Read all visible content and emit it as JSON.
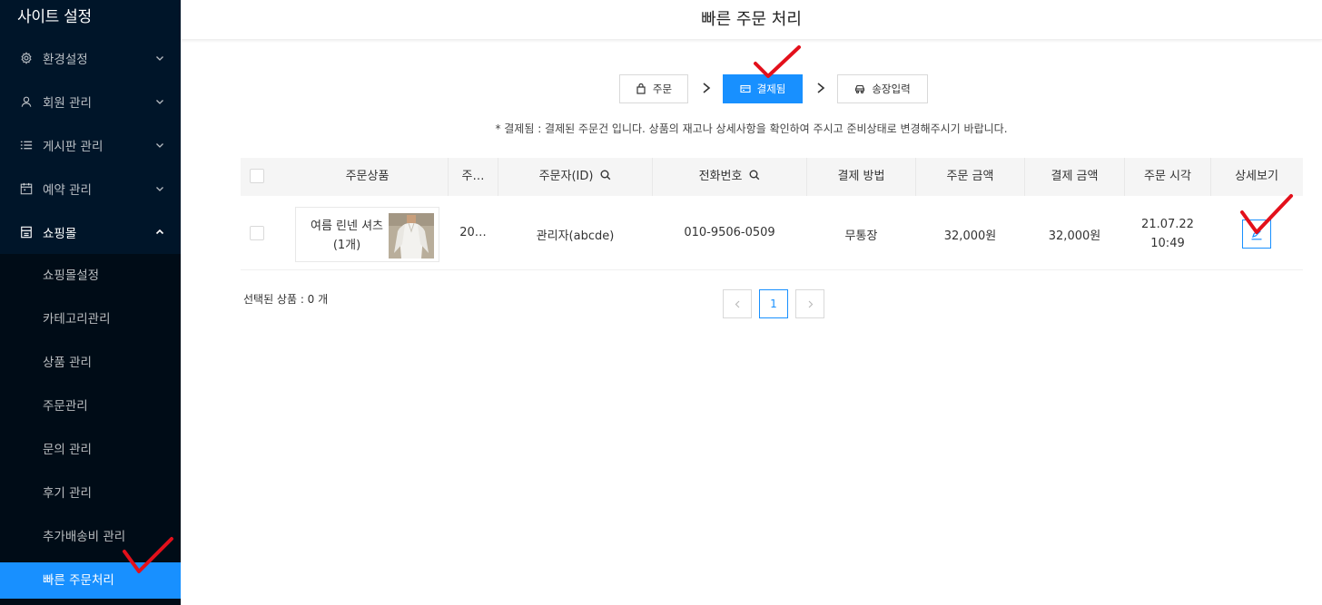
{
  "sidebar": {
    "title": "사이트 설정",
    "menu": [
      {
        "label": "환경설정",
        "icon": "gear-icon"
      },
      {
        "label": "회원 관리",
        "icon": "user-icon"
      },
      {
        "label": "게시판 관리",
        "icon": "list-icon"
      },
      {
        "label": "예약 관리",
        "icon": "calendar-icon"
      },
      {
        "label": "쇼핑몰",
        "icon": "shop-icon"
      }
    ],
    "submenu": [
      {
        "label": "쇼핑몰설정"
      },
      {
        "label": "카테고리관리"
      },
      {
        "label": "상품 관리"
      },
      {
        "label": "주문관리"
      },
      {
        "label": "문의 관리"
      },
      {
        "label": "후기 관리"
      },
      {
        "label": "추가배송비 관리"
      },
      {
        "label": "빠른 주문처리"
      }
    ]
  },
  "header": {
    "title": "빠른 주문 처리"
  },
  "steps": [
    {
      "label": "주문",
      "icon": "bag-icon"
    },
    {
      "label": "결제됨",
      "icon": "credit-card-icon"
    },
    {
      "label": "송장입력",
      "icon": "car-icon"
    }
  ],
  "notice": "* 결제됨 : 결제된 주문건 입니다. 상품의 재고나 상세사항을 확인하여 주시고 준비상태로 변경해주시기 바랍니다.",
  "table": {
    "columns": [
      "주문상품",
      "주…",
      "주문자(ID)",
      "전화번호",
      "결제 방법",
      "주문 금액",
      "결제 금액",
      "주문 시각",
      "상세보기"
    ],
    "rows": [
      {
        "product": "여름 린넨 셔츠",
        "quantity": "(1개)",
        "order_no": "20…",
        "orderer": "관리자(abcde)",
        "phone": "010-9506-0509",
        "payment_method": "무통장",
        "order_amount": "32,000원",
        "paid_amount": "32,000원",
        "order_date": "21.07.22",
        "order_time": "10:49"
      }
    ]
  },
  "selected_count": "선택된 상품 : 0 개",
  "pagination": {
    "current": "1"
  },
  "colors": {
    "sidebar_bg": "#001529",
    "submenu_bg": "#000c17",
    "accent": "#1890ff",
    "annotation": "#e3101b"
  }
}
